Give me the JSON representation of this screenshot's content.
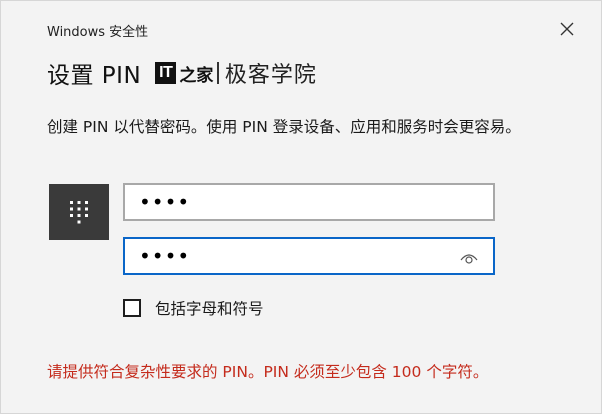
{
  "window": {
    "title": "Windows 安全性"
  },
  "heading": {
    "text": "设置 PIN",
    "logo_it": "IT",
    "logo_script": "之家",
    "logo_name": "极客学院"
  },
  "description": "创建 PIN 以代替密码。使用 PIN 登录设备、应用和服务时会更容易。",
  "pin_field": {
    "value": "••••"
  },
  "confirm_pin_field": {
    "value": "••••"
  },
  "checkbox": {
    "label": "包括字母和符号",
    "checked": false
  },
  "error": {
    "text": "请提供符合复杂性要求的 PIN。PIN 必须至少包含 100 个字符。",
    "color": "#c42b1c"
  },
  "colors": {
    "focus_border": "#0a66c8",
    "keypad_tile": "#3a3a3a",
    "dialog_bg": "#f3f3f3"
  },
  "icons": {
    "keypad": "keypad-icon",
    "reveal": "eye-icon",
    "close": "close-icon"
  }
}
